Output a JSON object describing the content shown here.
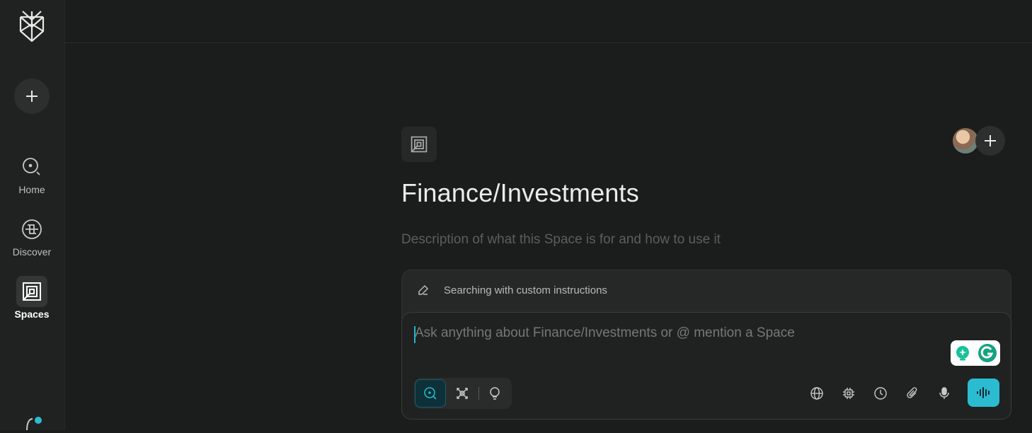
{
  "nav": {
    "items": [
      {
        "label": "Home"
      },
      {
        "label": "Discover"
      },
      {
        "label": "Spaces"
      }
    ]
  },
  "space": {
    "title": "Finance/Investments",
    "description": "Description of what this Space is for and how to use it"
  },
  "instructions": {
    "label": "Searching with custom instructions"
  },
  "composer": {
    "placeholder": "Ask anything about Finance/Investments or @ mention a Space"
  },
  "colors": {
    "accent": "#20b8cd",
    "background": "#1b1c1c",
    "sidebar": "#202222"
  }
}
